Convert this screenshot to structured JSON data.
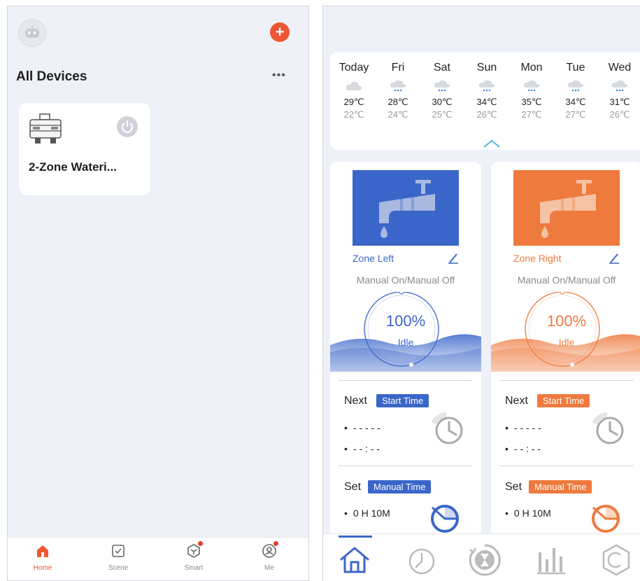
{
  "home": {
    "section_title": "All Devices",
    "more_label": "•••",
    "add_label": "+",
    "device": {
      "name": "2-Zone Wateri..."
    },
    "tabs": [
      {
        "label": "Home",
        "icon": "home-icon",
        "active": true
      },
      {
        "label": "Scene",
        "icon": "scene-icon",
        "active": false
      },
      {
        "label": "Smart",
        "icon": "smart-icon",
        "active": false
      },
      {
        "label": "Me",
        "icon": "me-icon",
        "active": false
      }
    ]
  },
  "weather": {
    "days": [
      {
        "name": "Today",
        "high": "29℃",
        "low": "22℃",
        "icon": "cloud-icon"
      },
      {
        "name": "Fri",
        "high": "28℃",
        "low": "24℃",
        "icon": "rain-cloud-icon"
      },
      {
        "name": "Sat",
        "high": "30℃",
        "low": "25℃",
        "icon": "rain-cloud-icon"
      },
      {
        "name": "Sun",
        "high": "34℃",
        "low": "26℃",
        "icon": "rain-cloud-icon"
      },
      {
        "name": "Mon",
        "high": "35℃",
        "low": "27℃",
        "icon": "rain-cloud-icon"
      },
      {
        "name": "Tue",
        "high": "34℃",
        "low": "27℃",
        "icon": "rain-cloud-icon"
      },
      {
        "name": "Wed",
        "high": "31℃",
        "low": "26℃",
        "icon": "rain-cloud-icon"
      }
    ]
  },
  "zones": [
    {
      "name": "Zone Left",
      "color": "#3b66c9",
      "mode": "Manual On/Manual Off",
      "percent": "100%",
      "state": "Idle",
      "next_label": "Next",
      "start_badge": "Start Time",
      "next_date": "- - - - -",
      "next_time": "- - : - -",
      "set_label": "Set",
      "manual_badge": "Manual Time",
      "manual_value": "0 H 10M"
    },
    {
      "name": "Zone Right",
      "color": "#ee7a3e",
      "mode": "Manual On/Manual Off",
      "percent": "100%",
      "state": "Idle",
      "next_label": "Next",
      "start_badge": "Start Time",
      "next_date": "- - - - -",
      "next_time": "- - : - -",
      "set_label": "Set",
      "manual_badge": "Manual Time",
      "manual_value": "0 H 10M"
    }
  ],
  "bottom_nav": [
    {
      "icon": "home-icon",
      "active": true
    },
    {
      "icon": "clock-icon",
      "active": false
    },
    {
      "icon": "hourglass-icon",
      "active": false
    },
    {
      "icon": "bar-chart-icon",
      "active": false
    },
    {
      "icon": "settings-icon",
      "active": false
    }
  ]
}
